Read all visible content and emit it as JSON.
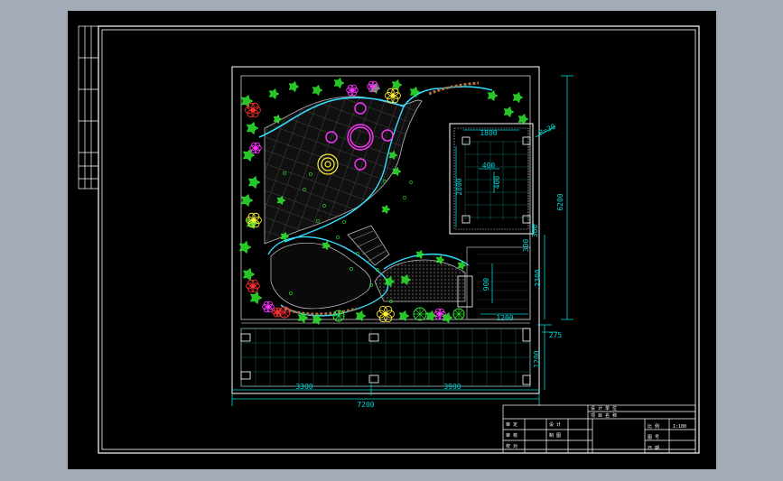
{
  "colors": {
    "background": "#a3abb8",
    "canvas": "#000000",
    "frame": "#ffffff",
    "dimension": "#00d5d5",
    "plant_green": "#2ee82e",
    "flower_magenta": "#ff33ff",
    "flower_yellow": "#ffee33",
    "flower_red": "#ff3030",
    "water": "#33ddff"
  },
  "dimensions": {
    "total_width": "7200",
    "bottom_left": "3300",
    "bottom_right": "3900",
    "right_height": "6200",
    "paving_height": "1200",
    "pergola_offset": "300",
    "step_height": "900",
    "stair_width": "1200",
    "right_lower": "2300",
    "offset_small": "275",
    "pergola_width": "1800",
    "pergola_depth": "2800",
    "tile_w": "400",
    "tile_h": "400",
    "radius_label": "R=30",
    "pergola_side": "300"
  },
  "title_block": {
    "labels": [
      "设 计 单 位",
      "项 目 名 称",
      "审 定",
      "审 核",
      "校 对",
      "设 计",
      "制 图",
      "比 例",
      "图 号",
      "日 期"
    ],
    "scale": "1:100"
  },
  "icons": [
    "flower-icon",
    "shrub-icon",
    "tree-icon",
    "grass-icon"
  ]
}
